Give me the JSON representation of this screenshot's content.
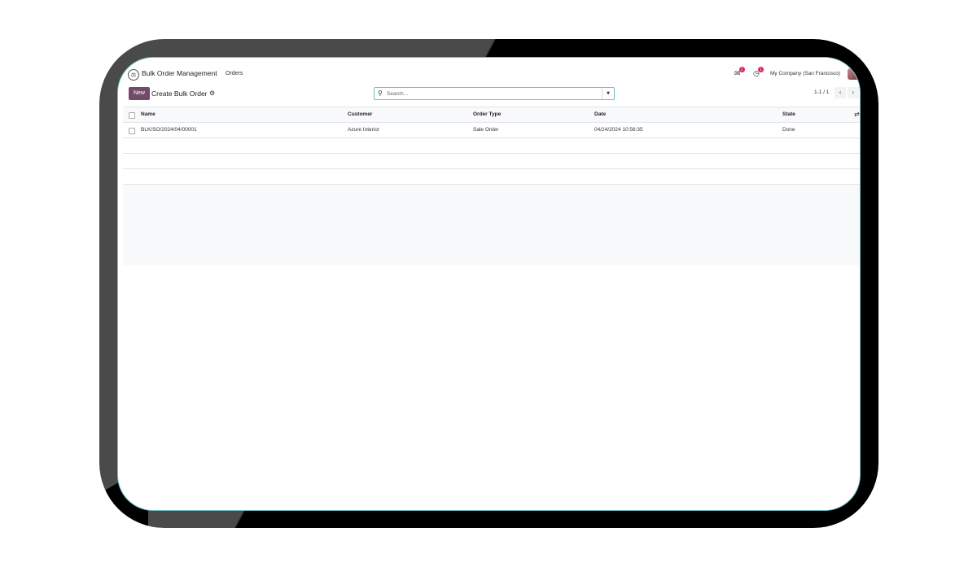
{
  "navbar": {
    "app_icon": "bulk-order-app-icon",
    "app_name": "Bulk Order Management",
    "menu": [
      "Orders"
    ],
    "messages_icon": "chat-icon",
    "messages_count": "1",
    "activity_icon": "clock-icon",
    "activity_count": "1",
    "company": "My Company (San Francisco)",
    "avatar_icon": "user-avatar"
  },
  "control_panel": {
    "new_button": "New",
    "title": "Create Bulk Order",
    "settings_icon": "gear-icon",
    "search": {
      "placeholder": "Search...",
      "value": "",
      "icon": "search-icon",
      "toggle_icon": "caret-down-icon"
    },
    "pager": {
      "value": "1-1 / 1",
      "prev_icon": "chevron-left-icon",
      "next_icon": "chevron-right-icon"
    }
  },
  "list": {
    "columns": [
      "Name",
      "Customer",
      "Order Type",
      "Date",
      "State"
    ],
    "optional_columns_icon": "sliders-icon",
    "rows": [
      {
        "name": "BLK/SO/2024/04/00001",
        "customer": "Azure Interior",
        "order_type": "Sale Order",
        "date": "04/24/2024 10:56:35",
        "state": "Done"
      }
    ]
  },
  "colors": {
    "primary": "#714b67",
    "badge": "#e0245e",
    "focus_border": "#6dc0c6"
  }
}
